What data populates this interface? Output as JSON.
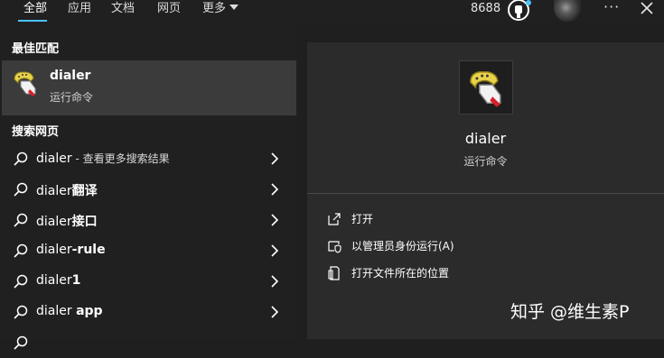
{
  "tabs": [
    {
      "label": "全部",
      "active": true
    },
    {
      "label": "应用",
      "active": false
    },
    {
      "label": "文档",
      "active": false
    },
    {
      "label": "网页",
      "active": false
    },
    {
      "label": "更多",
      "active": false
    }
  ],
  "header": {
    "points": "8688",
    "reward_icon": "medal-icon",
    "avatar": "user-avatar",
    "more_options_icon": "ellipsis-icon",
    "close_icon": "close-icon",
    "accent_color": "#4cc2ff"
  },
  "best_match": {
    "section_title": "最佳匹配",
    "name": "dialer",
    "subtitle": "运行命令",
    "icon": "dialer-phone-icon"
  },
  "web_search": {
    "section_title": "搜索网页",
    "items": [
      {
        "prefix": "dialer",
        "bold": "",
        "hint": " - 查看更多搜索结果"
      },
      {
        "prefix": "dialer",
        "bold": "翻译",
        "hint": ""
      },
      {
        "prefix": "dialer",
        "bold": "接口",
        "hint": ""
      },
      {
        "prefix": "dialer",
        "bold": "-rule",
        "hint": ""
      },
      {
        "prefix": "dialer",
        "bold": "1",
        "hint": ""
      },
      {
        "prefix": "dialer ",
        "bold": "app",
        "hint": ""
      }
    ]
  },
  "details": {
    "name": "dialer",
    "subtitle": "运行命令",
    "actions": [
      {
        "label": "打开",
        "icon": "open-icon"
      },
      {
        "label": "以管理员身份运行(A)",
        "icon": "shield-admin-icon"
      },
      {
        "label": "打开文件所在的位置",
        "icon": "file-location-icon"
      }
    ]
  },
  "watermark": "知乎 @维生素P"
}
